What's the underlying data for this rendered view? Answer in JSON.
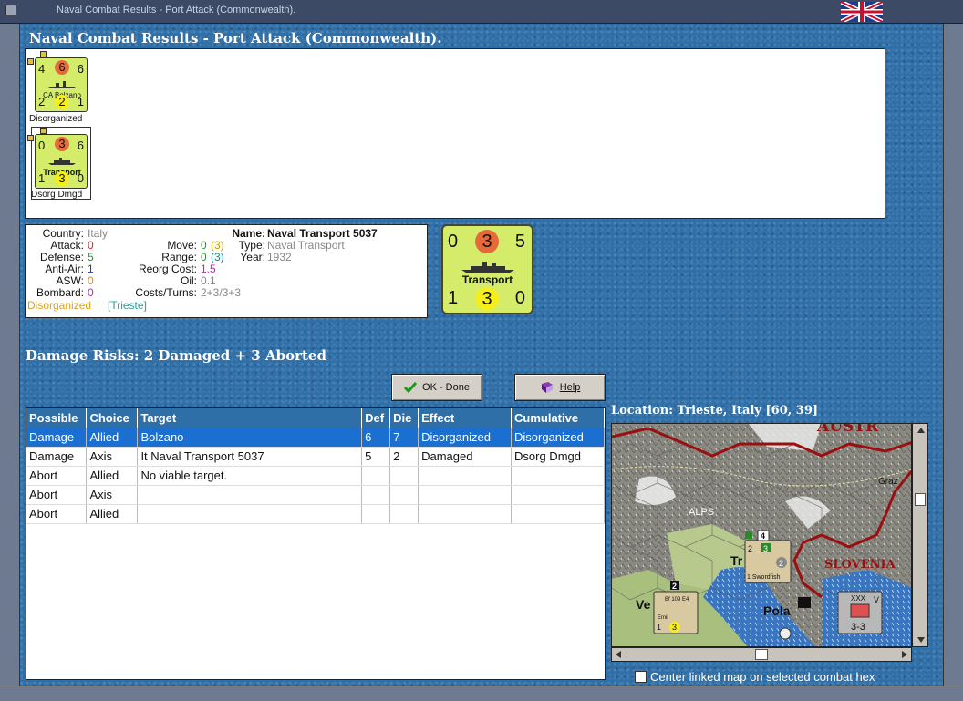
{
  "window": {
    "title": "Naval Combat Results - Port Attack (Commonwealth)."
  },
  "header": {
    "title": "Naval Combat Results - Port Attack (Commonwealth)."
  },
  "units": [
    {
      "tl": "4",
      "tc": "6",
      "tr": "6",
      "name": "CA Bolzano",
      "bl": "2",
      "bc": "2",
      "br": "1",
      "status": "Disorganized"
    },
    {
      "tl": "0",
      "tc": "3",
      "tr": "6",
      "name": "Transport",
      "bl": "1",
      "bc": "3",
      "br": "0",
      "status": "Dsorg Dmgd"
    }
  ],
  "info": {
    "country_label": "Country:",
    "country": "Italy",
    "attack_label": "Attack:",
    "attack": "0",
    "defense_label": "Defense:",
    "defense": "5",
    "antiair_label": "Anti-Air:",
    "antiair": "1",
    "asw_label": "ASW:",
    "asw": "0",
    "bombard_label": "Bombard:",
    "bombard": "0",
    "name_label": "Name:",
    "name": "Naval Transport 5037",
    "move_label": "Move:",
    "move": "0",
    "move_extra": "(3)",
    "range_label": "Range:",
    "range": "0",
    "range_extra": "(3)",
    "type_label": "Type:",
    "type": "Naval Transport",
    "year_label": "Year:",
    "year": "1932",
    "reorg_label": "Reorg Cost:",
    "reorg": "1.5",
    "oil_label": "Oil:",
    "oil": "0.1",
    "costs_label": "Costs/Turns:",
    "costs": "2+3/3+3",
    "status": "Disorganized",
    "location": "[Trieste]"
  },
  "bigcounter": {
    "tl": "0",
    "tc": "3",
    "tr": "5",
    "name": "Transport",
    "bl": "1",
    "bc": "3",
    "br": "0"
  },
  "damage_risks": "Damage Risks: 2 Damaged + 3 Aborted",
  "buttons": {
    "ok": "OK - Done",
    "help": "Help"
  },
  "table": {
    "headers": [
      "Possible",
      "Choice",
      "Target",
      "Def",
      "Die",
      "Effect",
      "Cumulative"
    ],
    "rows": [
      [
        "Damage",
        "Allied",
        "Bolzano",
        "6",
        "7",
        "Disorganized",
        "Disorganized"
      ],
      [
        "Damage",
        "Axis",
        "It Naval Transport 5037",
        "5",
        "2",
        "Damaged",
        "Dsorg Dmgd"
      ],
      [
        "Abort",
        "Allied",
        "No viable target.",
        "",
        "",
        "",
        ""
      ],
      [
        "Abort",
        "Axis",
        "",
        "",
        "",
        "",
        ""
      ],
      [
        "Abort",
        "Allied",
        "",
        "",
        "",
        "",
        ""
      ]
    ]
  },
  "location": "Location:  Trieste, Italy [60, 39]",
  "map": {
    "labels": {
      "austria": "AUSTR",
      "graz": "Graz",
      "alps": "ALPS",
      "slovenia": "SLOVENIA",
      "pola": "Pola",
      "trieste": "Tr",
      "venice": "Ve"
    },
    "unit1": {
      "top": "4",
      "name": "1 Swordfish",
      "tl": "2",
      "tc": "3",
      "br": "2"
    },
    "unit2": {
      "top": "2",
      "name": "Bf 109 E4",
      "sub": "Emil",
      "bl": "1",
      "bc": "3"
    },
    "unit3": {
      "top": "XXX",
      "strength": "3-3",
      "corner": "V"
    }
  },
  "checkbox_label": "Center linked map on selected combat hex",
  "colors": {
    "sea": "#2f6fa8",
    "counter_axis": "#d4ec6a",
    "selection": "#1a6fd0"
  }
}
